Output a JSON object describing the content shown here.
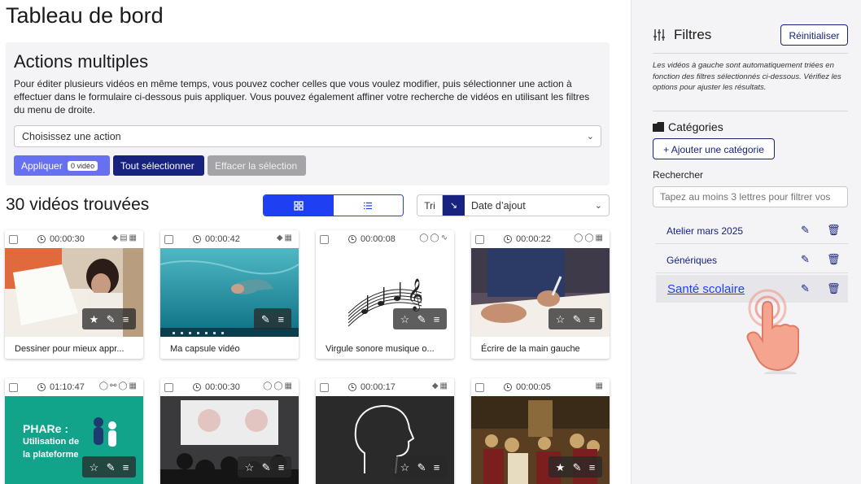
{
  "page": {
    "title": "Tableau de bord"
  },
  "actions": {
    "title": "Actions multiples",
    "description": "Pour éditer plusieurs vidéos en même temps, vous pouvez cocher celles que vous voulez modifier, puis sélectionner une action à effectuer dans le formulaire ci-dessous puis appliquer. Vous pouvez également affiner votre recherche de vidéos en utilisant les filtres du menu de droite.",
    "select_placeholder": "Choisissez une action",
    "apply_label": "Appliquer",
    "apply_count": "0 vidéo",
    "select_all_label": "Tout sélectionner",
    "clear_label": "Effacer la sélection"
  },
  "results": {
    "count_label": "30 vidéos trouvées",
    "sort_label": "Tri",
    "sort_value": "Date d’ajout"
  },
  "videos": [
    {
      "duration": "00:00:30",
      "title": "Dessiner pour mieux appr..."
    },
    {
      "duration": "00:00:42",
      "title": "Ma capsule vidéo"
    },
    {
      "duration": "00:00:08",
      "title": "Virgule sonore musique o..."
    },
    {
      "duration": "00:00:22",
      "title": "Écrire de la main gauche"
    },
    {
      "duration": "01:10:47",
      "title": "",
      "thumb_text": [
        "PHARe :",
        "Utilisation de",
        "la plateforme"
      ]
    },
    {
      "duration": "00:00:30",
      "title": ""
    },
    {
      "duration": "00:00:17",
      "title": ""
    },
    {
      "duration": "00:00:05",
      "title": ""
    }
  ],
  "filters": {
    "title": "Filtres",
    "reset_label": "Réinitialiser",
    "help": "Les vidéos à gauche sont automatiquement triées en fonction des filtres sélectionnés ci-dessous. Vérifiez les options pour ajuster les résultats.",
    "categories_title": "Catégories",
    "add_category_label": "+ Ajouter une catégorie",
    "search_label": "Rechercher",
    "search_placeholder": "Tapez au moins 3 lettres pour filtrer vos",
    "categories": [
      {
        "label": "Atelier mars 2025"
      },
      {
        "label": "Génériques"
      },
      {
        "label": "Santé scolaire"
      }
    ]
  },
  "colors": {
    "primary": "#1f3ff2",
    "navy": "#17237e",
    "apply": "#6770f0",
    "sidebar_bg": "#f4f4f6",
    "pointer": "#f08a7a"
  }
}
